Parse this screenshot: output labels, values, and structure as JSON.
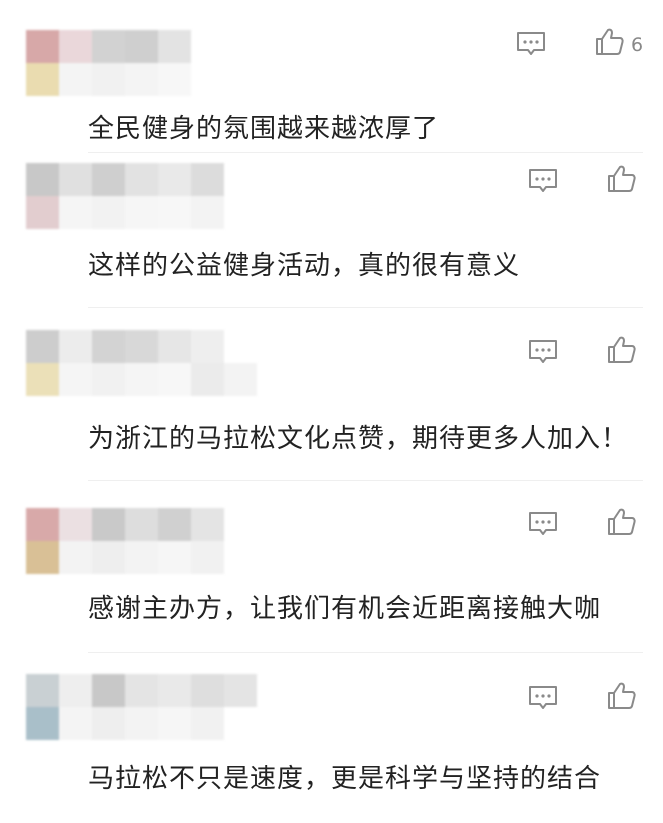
{
  "comments": [
    {
      "text": "全民健身的氛围越来越浓厚了",
      "likes": "6"
    },
    {
      "text": "这样的公益健身活动，真的很有意义",
      "likes": ""
    },
    {
      "text": "为浙江的马拉松文化点赞，期待更多人加入！",
      "likes": ""
    },
    {
      "text": "感谢主办方，让我们有机会近距离接触大咖",
      "likes": ""
    },
    {
      "text": "马拉松不只是速度，更是科学与坚持的结合",
      "likes": ""
    }
  ],
  "icons": {
    "reply": "comment-icon",
    "like": "thumbs-up-icon"
  },
  "colors": {
    "text": "#222222",
    "icon": "#8a8a8a",
    "divider": "#efefef"
  }
}
